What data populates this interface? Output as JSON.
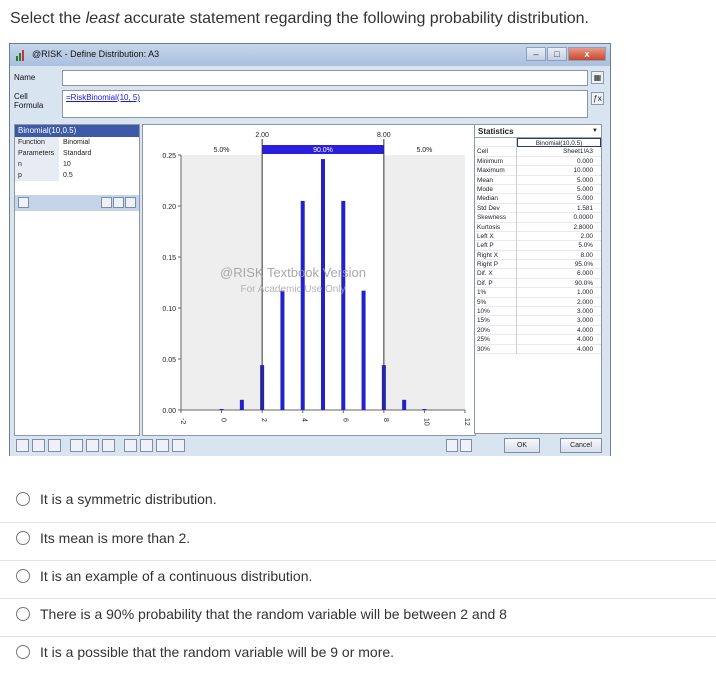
{
  "question": {
    "before": "Select the ",
    "emphasis": "least",
    "after": " accurate statement regarding the following probability distribution."
  },
  "window": {
    "title": "@RISK - Define Distribution: A3",
    "name_label": "Name",
    "name_value": "",
    "cell_label_1": "Cell",
    "cell_label_2": "Formula",
    "formula_value": "=RiskBinomial(10, 5)",
    "controls": {
      "minimize": "–",
      "maximize": "□",
      "close": "x"
    }
  },
  "left_panel": {
    "header": "Binomial(10,0.5)",
    "rows": [
      {
        "key": "Function",
        "value": "Binomial"
      },
      {
        "key": "Parameters",
        "value": "Standard"
      },
      {
        "key": "n",
        "value": "10"
      },
      {
        "key": "p",
        "value": "0.5"
      }
    ]
  },
  "chart_data": {
    "type": "bar",
    "x": [
      0,
      1,
      2,
      3,
      4,
      5,
      6,
      7,
      8,
      9,
      10
    ],
    "values": [
      0.001,
      0.01,
      0.044,
      0.117,
      0.205,
      0.246,
      0.205,
      0.117,
      0.044,
      0.01,
      0.001
    ],
    "ylim": [
      0,
      0.25
    ],
    "y_ticks": [
      "0.00",
      "0.05",
      "0.10",
      "0.15",
      "0.20",
      "0.25"
    ],
    "x_ticks": [
      "-2",
      "0",
      "2",
      "4",
      "6",
      "8",
      "10",
      "12"
    ],
    "x_tick_values": [
      -2,
      0,
      2,
      4,
      6,
      8,
      10,
      12
    ],
    "xlim": [
      -2,
      12
    ],
    "delimiters": {
      "left": "2.00",
      "right": "8.00"
    },
    "band_labels": {
      "left": "5.0%",
      "middle": "90.0%",
      "right": "5.0%"
    },
    "watermark_line1": "@RISK Textbook Version",
    "watermark_line2": "For Academic Use Only",
    "bar_color": "#2222cc"
  },
  "stats": {
    "header": "Statistics",
    "rows": [
      {
        "key": "",
        "value": "Binomial(10,0.5)",
        "boxed": true
      },
      {
        "key": "Cell",
        "value": "Sheet1!A3"
      },
      {
        "key": "Minimum",
        "value": "0.000"
      },
      {
        "key": "Maximum",
        "value": "10.000"
      },
      {
        "key": "Mean",
        "value": "5.000"
      },
      {
        "key": "Mode",
        "value": "5.000"
      },
      {
        "key": "Median",
        "value": "5.000"
      },
      {
        "key": "Std Dev",
        "value": "1.581"
      },
      {
        "key": "Skewness",
        "value": "0.0000"
      },
      {
        "key": "Kurtosis",
        "value": "2.8000"
      },
      {
        "key": "Left X",
        "value": "2.00"
      },
      {
        "key": "Left P",
        "value": "5.0%"
      },
      {
        "key": "Right X",
        "value": "8.00"
      },
      {
        "key": "Right P",
        "value": "95.0%"
      },
      {
        "key": "Dif. X",
        "value": "6.000"
      },
      {
        "key": "Dif. P",
        "value": "90.0%"
      },
      {
        "key": "1%",
        "value": "1.000"
      },
      {
        "key": "5%",
        "value": "2.000"
      },
      {
        "key": "10%",
        "value": "3.000"
      },
      {
        "key": "15%",
        "value": "3.000"
      },
      {
        "key": "20%",
        "value": "4.000"
      },
      {
        "key": "25%",
        "value": "4.000"
      },
      {
        "key": "30%",
        "value": "4.000"
      }
    ]
  },
  "buttons": {
    "ok": "OK",
    "cancel": "Cancel"
  },
  "choices": [
    "It is a symmetric distribution.",
    "Its mean is more than 2.",
    "It is an example of a continuous distribution.",
    "There is a 90% probability that the random variable will be between 2 and 8",
    "It is a possible that the random variable will be 9 or more."
  ]
}
